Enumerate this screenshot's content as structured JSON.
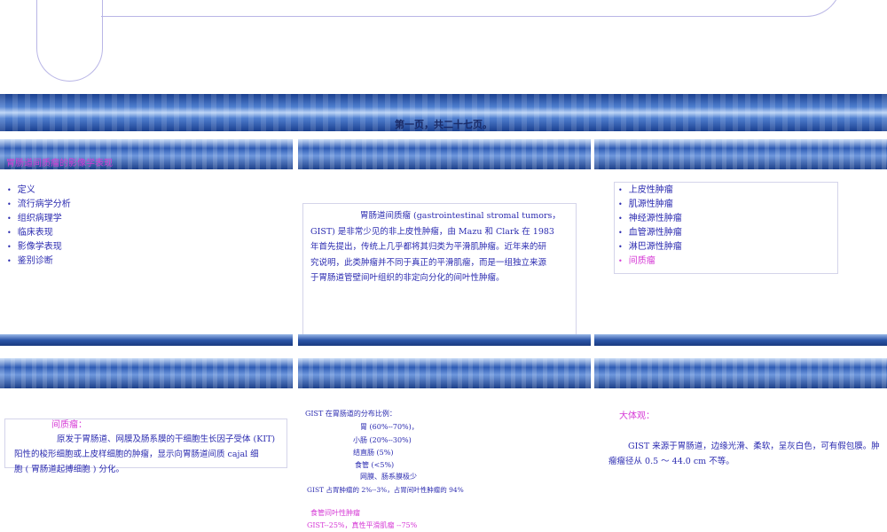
{
  "banner": {
    "page_label": "第一页，共二十七页。"
  },
  "slide1": {
    "title": "胃肠道间质瘤的影像学表现",
    "items": [
      "定义",
      "流行病学分析",
      "组织病理学",
      "临床表现",
      "影像学表现",
      "鉴别诊断"
    ]
  },
  "slide2": {
    "line1": "胃肠道间质瘤 (gastrointestinal stromal tumors，",
    "line2": "GIST) 是非常少见的非上皮性肿瘤，由 Mazu 和 Clark 在 1983",
    "line3": "年首先提出，传统上几乎都将其归类为平滑肌肿瘤。近年来的研",
    "line4": "究说明，此类肿瘤并不同于真正的平滑肌瘤，而是一组独立来源",
    "line5": "于胃肠道管壁间叶组织的非定向分化的间叶性肿瘤。"
  },
  "slide3": {
    "items": [
      "上皮性肿瘤",
      "肌源性肿瘤",
      "神经源性肿瘤",
      "血管源性肿瘤",
      "淋巴源性肿瘤"
    ],
    "highlight": "间质瘤"
  },
  "slide4": {
    "heading": "间质瘤：",
    "line1": "原发于胃肠道、网膜及肠系膜的干细胞生长因子受体 (KIT)",
    "line2": "阳性的梭形细胞或上皮样细胞的肿瘤，显示向胃肠道间质 cajal 细",
    "line3": "胞 ( 胃肠道起搏细胞 ) 分化。"
  },
  "slide5": {
    "intro": "GIST 在胃肠道的分布比例：",
    "stomach": "胃 (60%--70%)，",
    "small_intestine": "小肠 (20%--30%)",
    "colorectum": "结直肠 (5%)",
    "esophagus": "食管 (<5%)",
    "mesentery": "网膜、肠系膜极少",
    "gastric_share": "GIST 占胃肿瘤的 2%--3%，占胃间叶性肿瘤的 94%",
    "esophagus_heading": "食管间叶性肿瘤",
    "esophagus_share": "GIST--25%，真性平滑肌瘤 --75%"
  },
  "slide6": {
    "heading": "大体观：",
    "line1": "GIST 来源于胃肠道，边缘光滑、柔软，呈灰白色，可有假包膜。肿",
    "line2": "瘤瘤径从 0.5 ～ 44.0 cm 不等。"
  },
  "colors": {
    "text_blue": "#2b2bb0",
    "accent_magenta": "#d63ad6",
    "banner_dark": "#1a3f8f"
  }
}
